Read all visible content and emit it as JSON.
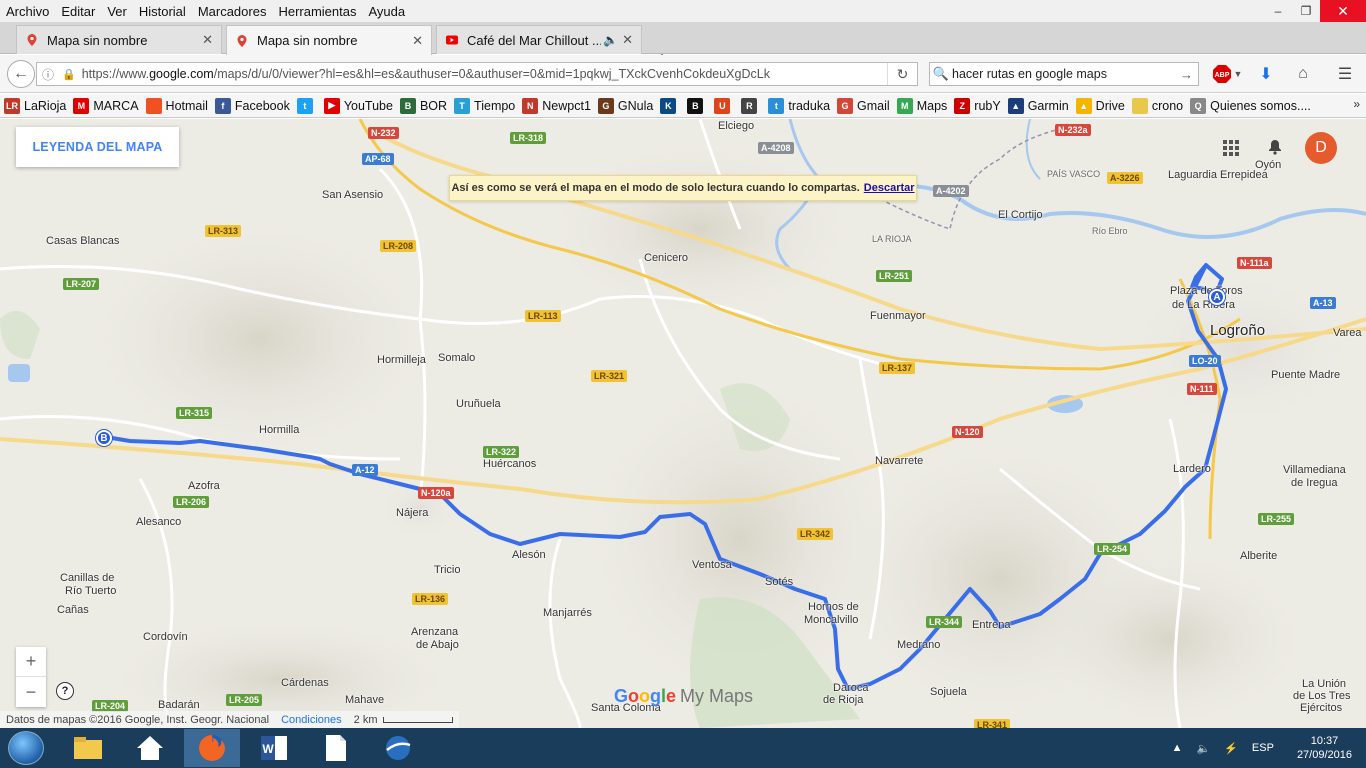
{
  "menu": [
    "Archivo",
    "Editar",
    "Ver",
    "Historial",
    "Marcadores",
    "Herramientas",
    "Ayuda"
  ],
  "window_controls": {
    "minimize": "–",
    "maximize": "❐",
    "close": "✕"
  },
  "tabs": [
    {
      "label": "Mapa sin nombre"
    },
    {
      "label": "Mapa sin nombre"
    },
    {
      "label": "Café del Mar Chillout ..."
    }
  ],
  "newtab_symbol": "+",
  "nav": {
    "url_prefix": "https://www.",
    "url_domain": "google.com",
    "url_rest": "/maps/d/u/0/viewer?hl=es&hl=es&authuser=0&authuser=0&mid=1pqkwj_TXckCvenhCokdeuXgDcLk",
    "search_value": "hacer rutas en google maps",
    "abp_label": "ABP"
  },
  "bookmarks": [
    {
      "label": "LaRioja",
      "color": "#c0392b",
      "glyph": "LR"
    },
    {
      "label": "MARCA",
      "color": "#e00000",
      "glyph": "M"
    },
    {
      "label": "Hotmail",
      "color": "#f25022",
      "glyph": ""
    },
    {
      "label": "Facebook",
      "color": "#3b5998",
      "glyph": "f"
    },
    {
      "label": "",
      "color": "#1da1f2",
      "glyph": "t"
    },
    {
      "label": "YouTube",
      "color": "#e00000",
      "glyph": "▶"
    },
    {
      "label": "BOR",
      "color": "#2e6b3a",
      "glyph": "B"
    },
    {
      "label": "Tiempo",
      "color": "#2a9fd6",
      "glyph": "T"
    },
    {
      "label": "Newpct1",
      "color": "#c0392b",
      "glyph": "N"
    },
    {
      "label": "GNula",
      "color": "#6b3a1a",
      "glyph": "G"
    },
    {
      "label": "",
      "color": "#0c4a87",
      "glyph": "K"
    },
    {
      "label": "",
      "color": "#111111",
      "glyph": "B"
    },
    {
      "label": "",
      "color": "#e0421a",
      "glyph": "U"
    },
    {
      "label": "",
      "color": "#444444",
      "glyph": "R"
    },
    {
      "label": "traduka",
      "color": "#2a8fd6",
      "glyph": "t"
    },
    {
      "label": "Gmail",
      "color": "#d44638",
      "glyph": "G"
    },
    {
      "label": "Maps",
      "color": "#34a853",
      "glyph": "M"
    },
    {
      "label": "rubY",
      "color": "#cc0000",
      "glyph": "Z"
    },
    {
      "label": "Garmin",
      "color": "#1b3d7a",
      "glyph": "▲"
    },
    {
      "label": "Drive",
      "color": "#f4b400",
      "glyph": "▲"
    },
    {
      "label": "crono",
      "color": "#e8c84a",
      "glyph": ""
    },
    {
      "label": "Quienes somos....",
      "color": "#888888",
      "glyph": "Q"
    }
  ],
  "map": {
    "legend_button": "LEYENDA DEL MAPA",
    "notice_text": "Así es como se verá el mapa en el modo de solo lectura cuando lo compartas.",
    "notice_link": "Descartar",
    "avatar_letter": "D",
    "zoom_in": "+",
    "zoom_out": "−",
    "help": "?",
    "attribution": "Datos de mapas ©2016 Google, Inst. Geogr. Nacional",
    "conditions": "Condiciones",
    "scale": "2 km",
    "logo_google": "Google",
    "logo_mymaps": "My Maps",
    "marker_a": "A",
    "marker_b": "B",
    "places": [
      {
        "name": "Elciego"
      },
      {
        "name": "San Asensio"
      },
      {
        "name": "Casas Blancas"
      },
      {
        "name": "Cenicero"
      },
      {
        "name": "El Cortijo"
      },
      {
        "name": "Oyón"
      },
      {
        "name": "Laguardia Errepidea"
      },
      {
        "name": "Plaza de Toros"
      },
      {
        "name": "de La Ribera"
      },
      {
        "name": "Logroño"
      },
      {
        "name": "Fuenmayor"
      },
      {
        "name": "Varea"
      },
      {
        "name": "Puente Madre"
      },
      {
        "name": "Hormilleja"
      },
      {
        "name": "Somalo"
      },
      {
        "name": "Uruñuela"
      },
      {
        "name": "Hormilla"
      },
      {
        "name": "Huércanos"
      },
      {
        "name": "Navarrete"
      },
      {
        "name": "Lardero"
      },
      {
        "name": "Villamediana"
      },
      {
        "name": "de Iregua"
      },
      {
        "name": "Azofra"
      },
      {
        "name": "Alesanco"
      },
      {
        "name": "Nájera"
      },
      {
        "name": "Alesón"
      },
      {
        "name": "Ventosa"
      },
      {
        "name": "Sotés"
      },
      {
        "name": "Hornos de"
      },
      {
        "name": "Moncalvillo"
      },
      {
        "name": "Medrano"
      },
      {
        "name": "Entrena"
      },
      {
        "name": "Alberite"
      },
      {
        "name": "Canillas de"
      },
      {
        "name": "Río Tuerto"
      },
      {
        "name": "Cañas"
      },
      {
        "name": "Tricio"
      },
      {
        "name": "Manjarrés"
      },
      {
        "name": "Cordovín"
      },
      {
        "name": "Arenzana"
      },
      {
        "name": "de Abajo"
      },
      {
        "name": "Cárdenas"
      },
      {
        "name": "Badarán"
      },
      {
        "name": "Mahave"
      },
      {
        "name": "Santa Coloma"
      },
      {
        "name": "Daroca"
      },
      {
        "name": "de Rioja"
      },
      {
        "name": "Sojuela"
      },
      {
        "name": "La Unión"
      },
      {
        "name": "de Los Tres"
      },
      {
        "name": "Ejércitos"
      },
      {
        "name": "Río Ebro"
      },
      {
        "name": "LA RIOJA"
      },
      {
        "name": "PAÍS VASCO"
      }
    ],
    "roads": [
      {
        "name": "N-232",
        "kind": "red"
      },
      {
        "name": "LR-318",
        "kind": "green"
      },
      {
        "name": "AP-68",
        "kind": "blue"
      },
      {
        "name": "A-4208",
        "kind": "gray"
      },
      {
        "name": "N-232a",
        "kind": "red"
      },
      {
        "name": "A-4202",
        "kind": "gray"
      },
      {
        "name": "A-3226",
        "kind": "orange"
      },
      {
        "name": "LR-313",
        "kind": "orange"
      },
      {
        "name": "LR-208",
        "kind": "orange"
      },
      {
        "name": "LR-207",
        "kind": "green"
      },
      {
        "name": "LR-251",
        "kind": "green"
      },
      {
        "name": "N-111a",
        "kind": "red"
      },
      {
        "name": "A-13",
        "kind": "blue"
      },
      {
        "name": "LR-113",
        "kind": "orange"
      },
      {
        "name": "LO-20",
        "kind": "blue"
      },
      {
        "name": "LR-321",
        "kind": "orange"
      },
      {
        "name": "LR-137",
        "kind": "orange"
      },
      {
        "name": "N-111",
        "kind": "red"
      },
      {
        "name": "LR-315",
        "kind": "green"
      },
      {
        "name": "N-120",
        "kind": "red"
      },
      {
        "name": "LR-322",
        "kind": "green"
      },
      {
        "name": "A-12",
        "kind": "blue"
      },
      {
        "name": "LR-206",
        "kind": "green"
      },
      {
        "name": "LR-342",
        "kind": "orange"
      },
      {
        "name": "LR-254",
        "kind": "green"
      },
      {
        "name": "LR-255",
        "kind": "green"
      },
      {
        "name": "LR-136",
        "kind": "orange"
      },
      {
        "name": "LR-344",
        "kind": "green"
      },
      {
        "name": "LR-341",
        "kind": "orange"
      },
      {
        "name": "LR-205",
        "kind": "green"
      },
      {
        "name": "LR-204",
        "kind": "green"
      },
      {
        "name": "N-120a",
        "kind": "red"
      }
    ]
  },
  "taskbar": {
    "language": "ESP",
    "time": "10:37",
    "date": "27/09/2016"
  },
  "colors": {
    "route": "#3a6ee8",
    "accent": "#4285f4"
  }
}
